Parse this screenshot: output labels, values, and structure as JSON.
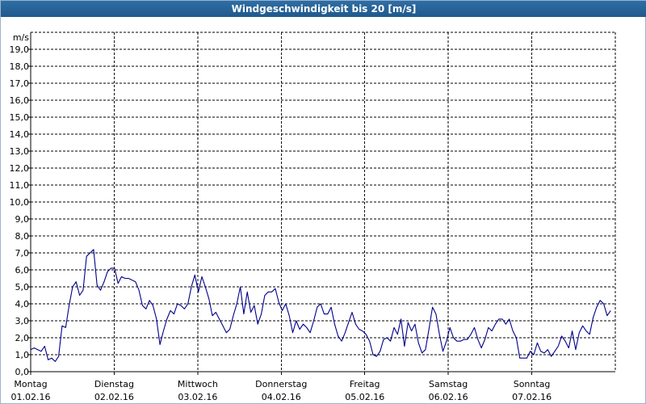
{
  "window": {
    "title": "Windgeschwindigkeit bis 20 [m/s]"
  },
  "colors": {
    "series": "#00008b",
    "grid": "#000000",
    "title_bar": "#1f5a8d"
  },
  "chart_data": {
    "type": "line",
    "ylabel": "m/s",
    "ylim": [
      0,
      20
    ],
    "yticks": [
      "0,0",
      "1,0",
      "2,0",
      "3,0",
      "4,0",
      "5,0",
      "6,0",
      "7,0",
      "8,0",
      "9,0",
      "10,0",
      "11,0",
      "12,0",
      "13,0",
      "14,0",
      "15,0",
      "16,0",
      "17,0",
      "18,0",
      "19,0"
    ],
    "xlim_days": [
      0,
      7
    ],
    "x_days": [
      {
        "day": "Montag",
        "date": "01.02.16"
      },
      {
        "day": "Dienstag",
        "date": "02.02.16"
      },
      {
        "day": "Mittwoch",
        "date": "03.02.16"
      },
      {
        "day": "Donnerstag",
        "date": "04.02.16"
      },
      {
        "day": "Freitag",
        "date": "05.02.16"
      },
      {
        "day": "Samstag",
        "date": "06.02.16"
      },
      {
        "day": "Sonntag",
        "date": "07.02.16"
      }
    ],
    "grid": true,
    "series": [
      {
        "values": [
          1.3,
          1.4,
          1.3,
          1.2,
          1.5,
          0.7,
          0.8,
          0.6,
          0.9,
          2.7,
          2.6,
          3.9,
          5.0,
          5.3,
          4.5,
          4.8,
          6.8,
          7.0,
          7.2,
          5.1,
          4.8,
          5.3,
          5.9,
          6.1,
          6.1,
          5.2,
          5.6,
          5.5,
          5.5,
          5.4,
          5.3,
          4.8,
          3.9,
          3.7,
          4.2,
          3.9,
          3.1,
          1.6,
          2.4,
          3.1,
          3.6,
          3.4,
          4.0,
          3.9,
          3.7,
          4.0,
          5.0,
          5.7,
          4.7,
          5.6,
          5.0,
          4.3,
          3.3,
          3.5,
          3.1,
          2.7,
          2.3,
          2.5,
          3.3,
          4.0,
          5.0,
          3.4,
          4.7,
          3.5,
          3.9,
          2.8,
          3.4,
          4.5,
          4.7,
          4.7,
          4.9,
          4.1,
          3.6,
          4.0,
          3.3,
          2.3,
          3.0,
          2.5,
          2.8,
          2.6,
          2.3,
          3.0,
          3.8,
          4.0,
          3.4,
          3.4,
          3.8,
          2.8,
          2.1,
          1.8,
          2.3,
          2.9,
          3.5,
          2.8,
          2.5,
          2.4,
          2.2,
          1.8,
          1.0,
          0.9,
          1.2,
          1.9,
          2.0,
          1.8,
          2.6,
          2.2,
          3.1,
          1.5,
          2.9,
          2.4,
          2.8,
          1.7,
          1.1,
          1.3,
          2.5,
          3.8,
          3.4,
          2.2,
          1.2,
          1.8,
          2.6,
          2.0,
          1.8,
          1.8,
          1.9,
          1.9,
          2.2,
          2.6,
          1.9,
          1.4,
          1.9,
          2.6,
          2.4,
          2.8,
          3.1,
          3.1,
          2.8,
          3.1,
          2.4,
          2.0,
          0.8,
          0.8,
          0.8,
          1.2,
          1.0,
          1.7,
          1.2,
          1.1,
          1.3,
          0.9,
          1.2,
          1.5,
          2.1,
          1.8,
          1.4,
          2.4,
          1.3,
          2.3,
          2.7,
          2.4,
          2.2,
          3.2,
          3.8,
          4.2,
          4.0,
          3.3,
          3.6
        ]
      }
    ]
  }
}
